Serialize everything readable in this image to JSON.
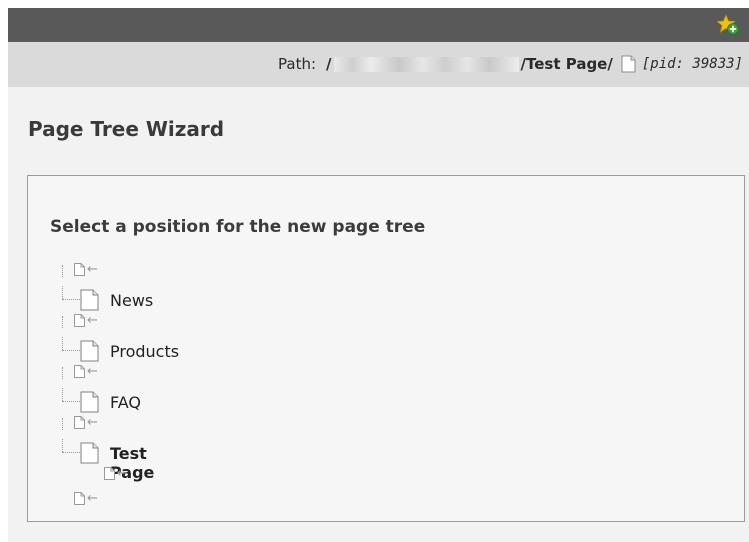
{
  "path_bar": {
    "label": "Path:",
    "prefix": "/",
    "current": "/Test Page/",
    "pid": "[pid: 39833]"
  },
  "wizard": {
    "title": "Page Tree Wizard",
    "heading": "Select a position for the new page tree"
  },
  "tree": {
    "pages": [
      "News",
      "Products",
      "FAQ",
      "Test Page"
    ]
  },
  "icons": {
    "bookmark": "star-plus-icon",
    "page": "page-icon",
    "insert": "insert-here-icon"
  },
  "colors": {
    "topbar": "#595959",
    "pathbar": "#dadada",
    "panel": "#f2f2f2"
  }
}
